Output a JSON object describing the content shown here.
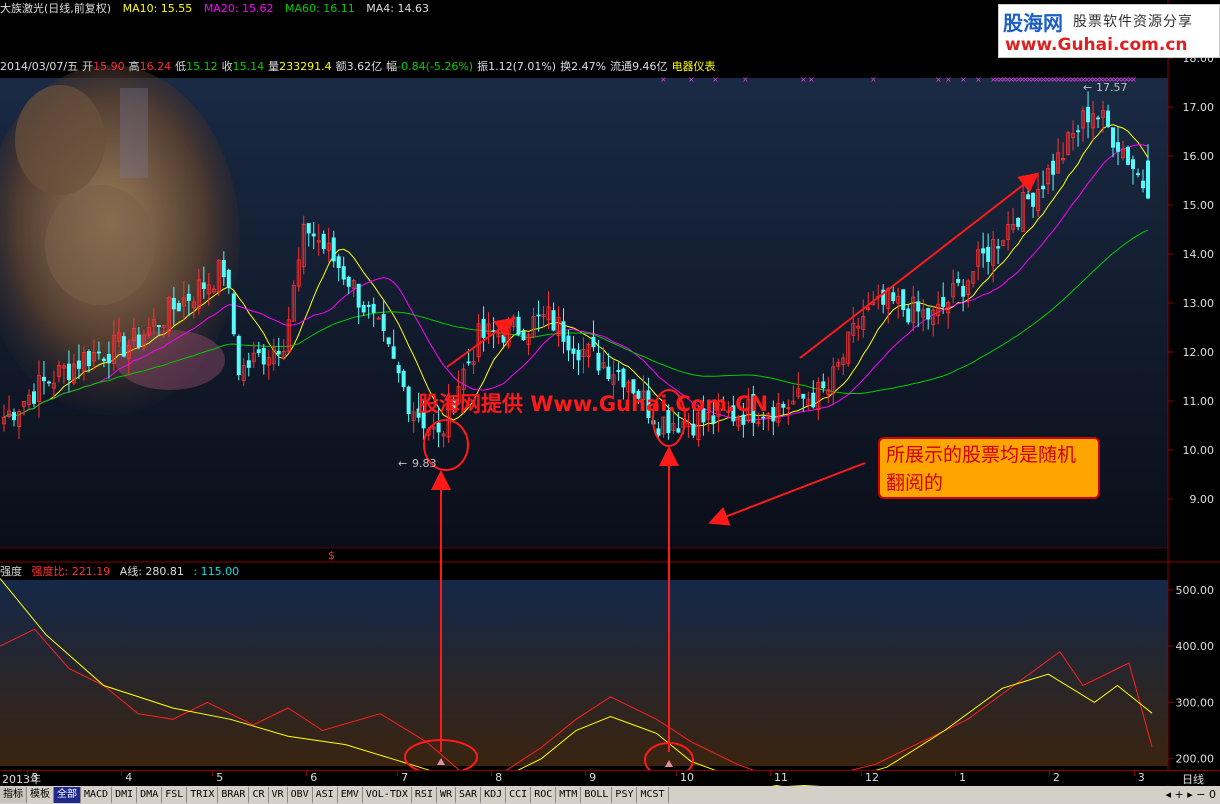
{
  "topbar": {
    "title": "大族激光(日线,前复权)",
    "ma10": "MA10: 15.55",
    "ma20": "MA20: 15.62",
    "ma60": "MA60: 16.11",
    "ma4": "MA4: 14.63"
  },
  "infobar": {
    "date": "2014/03/07/五",
    "open_label": "开",
    "open": "15.90",
    "high_label": "高",
    "high": "16.24",
    "low_label": "低",
    "low": "15.12",
    "close_label": "收",
    "close": "15.14",
    "vol_label": "量",
    "vol": "233291.4",
    "amt_label": "额",
    "amt": "3.62亿",
    "chg_label": "幅",
    "chg": "-0.84(-5.26%)",
    "amp_label": "振",
    "amp": "1.12(7.01%)",
    "turn_label": "换",
    "turn": "2.47%",
    "float_label": "流通",
    "float": "9.46亿",
    "sector": "电器仪表"
  },
  "logo": {
    "brand": "股海网",
    "slogan": "股票软件资源分享",
    "url": "www.Guhai.com.cn"
  },
  "annotations": {
    "watermark": "股海网提供 Www.Guhai.Com.CN",
    "callout": "所展示的股票均是随机翻阅的",
    "low_label": "9.83",
    "high_label": "17.57",
    "marker": "$"
  },
  "subbar": {
    "name": "强度",
    "strength_label": "强度比: 221.19",
    "aline_label": "A线: 280.81",
    "line_label": ": 115.00"
  },
  "datebar": {
    "year_label": "2013年",
    "labels": [
      "3",
      "4",
      "5",
      "6",
      "7",
      "8",
      "9",
      "10",
      "11",
      "12",
      "1",
      "2",
      "3"
    ],
    "period": "日线"
  },
  "toolbar": {
    "items": [
      "指标",
      "模板",
      "全部",
      "MACD",
      "DMI",
      "DMA",
      "FSL",
      "TRIX",
      "BRAR",
      "CR",
      "VR",
      "OBV",
      "ASI",
      "EMV",
      "VOL-TDX",
      "RSI",
      "WR",
      "SAR",
      "KDJ",
      "CCI",
      "ROC",
      "MTM",
      "BOLL",
      "PSY",
      "MCST"
    ],
    "active": "全部",
    "controls": "◂ + ▸ − 0"
  },
  "colors": {
    "up": "#ff3030",
    "down": "#54fcfc",
    "ma10": "#ffff00",
    "ma20": "#ff00ff",
    "ma60": "#00cc00",
    "axis_red": "#8b0000",
    "callout_bg": "#ffa500",
    "annotation": "#ff1a1a"
  },
  "chart_data": [
    {
      "type": "candlestick",
      "title": "大族激光(日线,前复权)",
      "period": "daily",
      "x_range": [
        "2013-02",
        "2014-03-07"
      ],
      "x_ticks": [
        "2013-03",
        "2013-04",
        "2013-05",
        "2013-06",
        "2013-07",
        "2013-08",
        "2013-09",
        "2013-10",
        "2013-11",
        "2013-12",
        "2014-01",
        "2014-02",
        "2014-03"
      ],
      "y_ticks": [
        9.0,
        10.0,
        11.0,
        12.0,
        13.0,
        14.0,
        15.0,
        16.0,
        17.0,
        18.0
      ],
      "ylim": [
        8.0,
        18.0
      ],
      "marked_low": 9.83,
      "marked_high": 17.57,
      "last": {
        "date": "2014-03-07",
        "open": 15.9,
        "high": 16.24,
        "low": 15.12,
        "close": 15.14
      },
      "close_path": [
        [
          "2013-02-20",
          10.6
        ],
        [
          "2013-03-05",
          11.3
        ],
        [
          "2013-03-20",
          11.9
        ],
        [
          "2013-04-05",
          12.2
        ],
        [
          "2013-04-20",
          13.0
        ],
        [
          "2013-05-05",
          13.7
        ],
        [
          "2013-05-10",
          11.6
        ],
        [
          "2013-05-25",
          12.3
        ],
        [
          "2013-06-01",
          14.6
        ],
        [
          "2013-06-15",
          13.5
        ],
        [
          "2013-06-25",
          12.4
        ],
        [
          "2013-07-05",
          11.0
        ],
        [
          "2013-07-15",
          10.2
        ],
        [
          "2013-07-20",
          11.2
        ],
        [
          "2013-07-28",
          12.3
        ],
        [
          "2013-08-10",
          12.5
        ],
        [
          "2013-08-20",
          12.7
        ],
        [
          "2013-09-01",
          12.0
        ],
        [
          "2013-09-15",
          11.5
        ],
        [
          "2013-09-25",
          10.6
        ],
        [
          "2013-10-10",
          10.6
        ],
        [
          "2013-10-25",
          10.8
        ],
        [
          "2013-11-05",
          10.9
        ],
        [
          "2013-11-20",
          11.2
        ],
        [
          "2013-12-01",
          12.7
        ],
        [
          "2013-12-10",
          13.0
        ],
        [
          "2013-12-25",
          12.7
        ],
        [
          "2014-01-05",
          13.5
        ],
        [
          "2014-01-20",
          14.7
        ],
        [
          "2014-02-05",
          16.0
        ],
        [
          "2014-02-15",
          17.0
        ],
        [
          "2014-02-25",
          16.2
        ],
        [
          "2014-03-07",
          15.14
        ]
      ],
      "series": [
        {
          "name": "MA10",
          "last": 15.55,
          "color": "#ffff00"
        },
        {
          "name": "MA20",
          "last": 15.62,
          "color": "#ff00ff"
        },
        {
          "name": "MA60",
          "last": 16.11,
          "color": "#00cc00"
        }
      ]
    },
    {
      "type": "line",
      "title": "强度",
      "ylim": [
        100,
        560
      ],
      "y_ticks": [
        200.0,
        300.0,
        400.0,
        500.0
      ],
      "series": [
        {
          "name": "强度比",
          "color": "#ff2020",
          "last": 221.19,
          "values": [
            [
              0,
              400
            ],
            [
              3,
              430
            ],
            [
              6,
              360
            ],
            [
              9,
              330
            ],
            [
              12,
              280
            ],
            [
              15,
              270
            ],
            [
              18,
              300
            ],
            [
              22,
              260
            ],
            [
              25,
              290
            ],
            [
              28,
              250
            ],
            [
              33,
              280
            ],
            [
              37,
              230
            ],
            [
              41,
              160
            ],
            [
              44,
              180
            ],
            [
              47,
              220
            ],
            [
              50,
              270
            ],
            [
              53,
              310
            ],
            [
              57,
              270
            ],
            [
              60,
              230
            ],
            [
              64,
              190
            ],
            [
              68,
              160
            ],
            [
              72,
              170
            ],
            [
              76,
              190
            ],
            [
              80,
              230
            ],
            [
              84,
              270
            ],
            [
              88,
              330
            ],
            [
              92,
              390
            ],
            [
              94,
              330
            ],
            [
              98,
              370
            ],
            [
              100,
              221.19
            ]
          ]
        },
        {
          "name": "A线",
          "color": "#ffff00",
          "last": 280.81,
          "values": [
            [
              0,
              520
            ],
            [
              4,
              420
            ],
            [
              9,
              330
            ],
            [
              15,
              290
            ],
            [
              20,
              270
            ],
            [
              25,
              240
            ],
            [
              30,
              225
            ],
            [
              34,
              200
            ],
            [
              38,
              175
            ],
            [
              41,
              158
            ],
            [
              44,
              170
            ],
            [
              47,
              200
            ],
            [
              50,
              250
            ],
            [
              53,
              275
            ],
            [
              57,
              245
            ],
            [
              60,
              195
            ],
            [
              64,
              165
            ],
            [
              68,
              150
            ],
            [
              72,
              155
            ],
            [
              77,
              185
            ],
            [
              82,
              250
            ],
            [
              87,
              325
            ],
            [
              91,
              350
            ],
            [
              95,
              300
            ],
            [
              97,
              330
            ],
            [
              100,
              280.81
            ]
          ]
        },
        {
          "name": "基准线",
          "color": "#00e0e0",
          "last": 115.0,
          "values": [
            [
              0,
              115
            ],
            [
              100,
              115
            ]
          ]
        }
      ]
    }
  ]
}
